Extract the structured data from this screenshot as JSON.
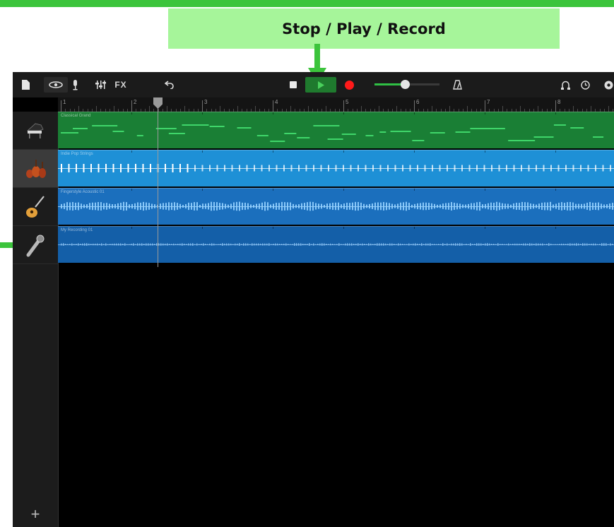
{
  "callout": {
    "label": "Stop / Play / Record"
  },
  "colors": {
    "banner": "#3cc43c",
    "callout_bg": "#a6f59a",
    "arrow": "#3cc43c",
    "piano_region": "#1a7f35",
    "strings_region": "#1e90d6",
    "guitar_region": "#1b6fbd",
    "mic_region": "#145fa8"
  },
  "toolbar": {
    "tracks_icon": "document-icon",
    "view_icon": "eye-icon",
    "mic_icon": "microphone-icon",
    "mixer_icon": "sliders-icon",
    "fx_label": "FX",
    "undo_icon": "undo-icon",
    "stop_icon": "stop-icon",
    "play_icon": "play-icon",
    "record_icon": "record-icon",
    "volume_level": 0.47,
    "metronome_icon": "metronome-icon",
    "loop_icon": "loop-icon",
    "clock_icon": "clock-icon",
    "settings_icon": "settings-icon"
  },
  "ruler": {
    "bars": [
      "1",
      "2",
      "3",
      "4",
      "5",
      "6",
      "7",
      "8"
    ]
  },
  "tracks": [
    {
      "icon": "grand-piano-icon",
      "region_name": "Classical Grand",
      "selected": false
    },
    {
      "icon": "strings-icon",
      "region_name": "Indie Pop Strings",
      "selected": true
    },
    {
      "icon": "acoustic-guitar-icon",
      "region_name": "Fingerstyle Acoustic 01",
      "selected": false
    },
    {
      "icon": "microphone-icon",
      "region_name": "My Recording 01",
      "selected": false
    }
  ],
  "sidebar": {
    "add_label": "+"
  }
}
